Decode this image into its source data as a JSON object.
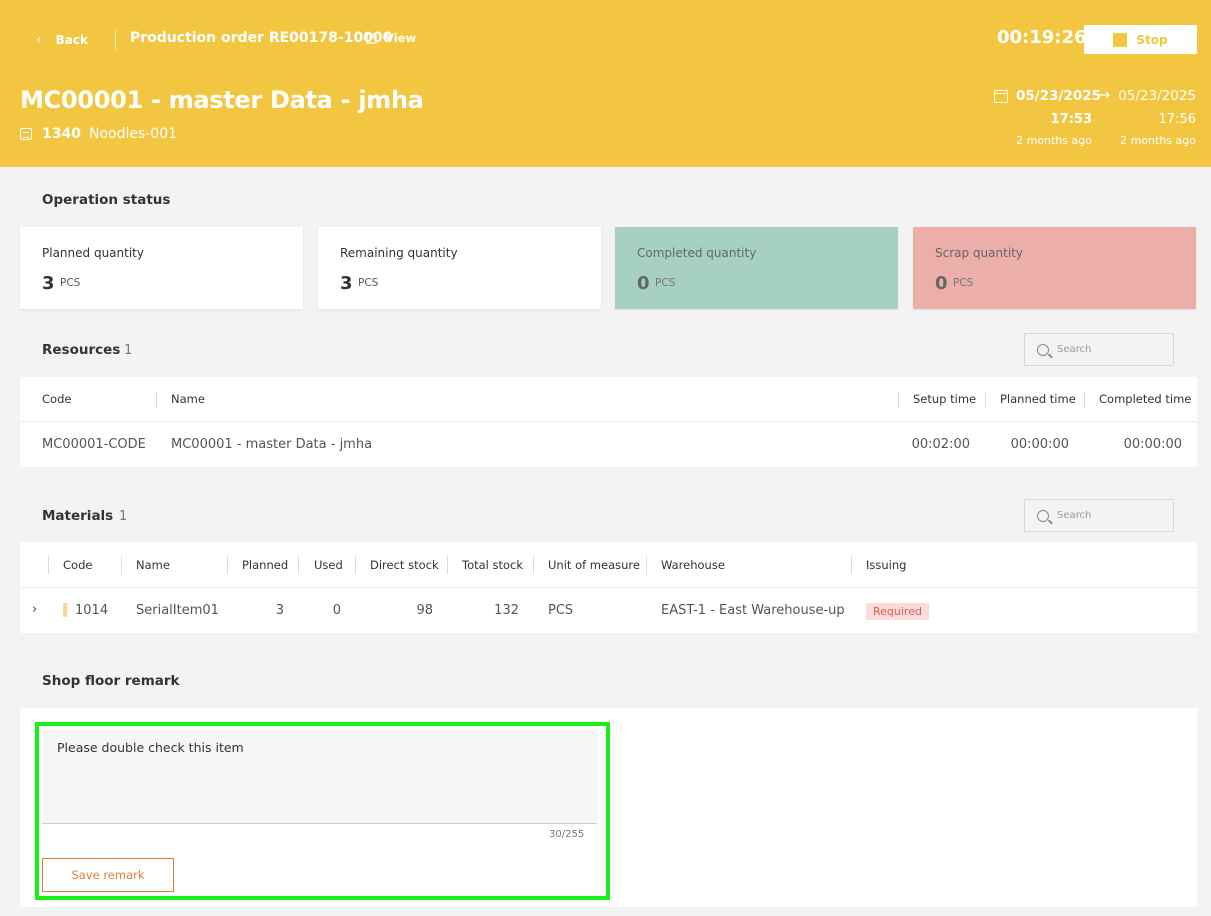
{
  "header": {
    "back_label": "Back",
    "production_order": "Production order RE00178-10000",
    "view_label": "View",
    "timer": "00:19:26",
    "stop_label": "Stop",
    "title": "MC00001 - master Data - jmha",
    "sub_code": "1340",
    "sub_name": "Noodles-001",
    "start_date": "05/23/2025",
    "end_date": "05/23/2025",
    "start_time": "17:53",
    "end_time": "17:56",
    "start_ago": "2 months ago",
    "end_ago": "2 months ago"
  },
  "operation_status": {
    "title": "Operation status",
    "cards": [
      {
        "label": "Planned quantity",
        "value": "3",
        "unit": "PCS"
      },
      {
        "label": "Remaining quantity",
        "value": "3",
        "unit": "PCS"
      },
      {
        "label": "Completed quantity",
        "value": "0",
        "unit": "PCS"
      },
      {
        "label": "Scrap quantity",
        "value": "0",
        "unit": "PCS"
      }
    ]
  },
  "resources": {
    "title": "Resources",
    "count": "1",
    "search_placeholder": "Search",
    "columns": [
      "Code",
      "Name",
      "Setup time",
      "Planned time",
      "Completed time"
    ],
    "rows": [
      {
        "code": "MC00001-CODE",
        "name": "MC00001 - master Data - jmha",
        "setup_time": "00:02:00",
        "planned_time": "00:00:00",
        "completed_time": "00:00:00"
      }
    ]
  },
  "materials": {
    "title": "Materials",
    "count": "1",
    "search_placeholder": "Search",
    "columns": [
      "Code",
      "Name",
      "Planned",
      "Used",
      "Direct stock",
      "Total stock",
      "Unit of measure",
      "Warehouse",
      "Issuing"
    ],
    "rows": [
      {
        "code": "1014",
        "name": "SerialItem01",
        "planned": "3",
        "used": "0",
        "direct_stock": "98",
        "total_stock": "132",
        "uom": "PCS",
        "warehouse": "EAST-1 - East Warehouse-up",
        "issuing": "Required"
      }
    ]
  },
  "remark": {
    "title": "Shop floor remark",
    "value": "Please double check this item",
    "char_count": "30/255",
    "save_label": "Save remark"
  },
  "colors": {
    "header_bg": "#f2c641",
    "completed_card": "#a5d0c3",
    "scrap_card": "#ecaea8",
    "save_button": "#e07e3c",
    "highlight": "#18f018"
  }
}
